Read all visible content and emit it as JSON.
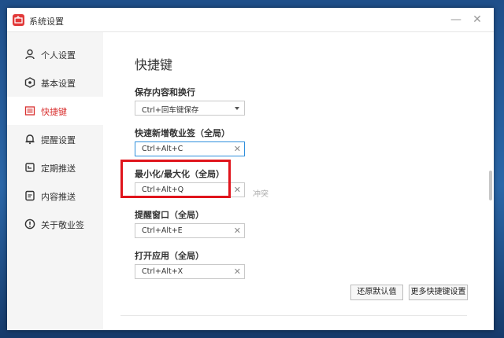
{
  "window": {
    "title": "系统设置",
    "min_symbol": "—",
    "close_symbol": "✕"
  },
  "sidebar": {
    "items": [
      {
        "label": "个人设置",
        "icon": "user-icon"
      },
      {
        "label": "基本设置",
        "icon": "settings-icon"
      },
      {
        "label": "快捷键",
        "icon": "keyboard-icon",
        "active": true
      },
      {
        "label": "提醒设置",
        "icon": "bell-icon"
      },
      {
        "label": "定期推送",
        "icon": "calendar-icon"
      },
      {
        "label": "内容推送",
        "icon": "document-icon"
      },
      {
        "label": "关于敬业签",
        "icon": "info-icon"
      }
    ]
  },
  "main": {
    "title": "快捷键",
    "fields": [
      {
        "label": "保存内容和换行",
        "value": "Ctrl+回车键保存",
        "type": "select"
      },
      {
        "label": "快速新增敬业签（全局）",
        "value": "Ctrl+Alt+C",
        "type": "input",
        "clear": "✕"
      },
      {
        "label": "最小化/最大化（全局）",
        "value": "Ctrl+Alt+Q",
        "type": "input",
        "clear": "✕",
        "status": "冲突"
      },
      {
        "label": "提醒窗口（全局）",
        "value": "Ctrl+Alt+E",
        "type": "input",
        "clear": "✕"
      },
      {
        "label": "打开应用（全局）",
        "value": "Ctrl+Alt+X",
        "type": "input",
        "clear": "✕"
      }
    ],
    "buttons": {
      "restore": "还原默认值",
      "more": "更多快捷键设置"
    }
  },
  "colors": {
    "accent": "#d9302f",
    "highlight": "#e0141c",
    "focus": "#2f8fdc",
    "desktop": "#2b67a8"
  }
}
